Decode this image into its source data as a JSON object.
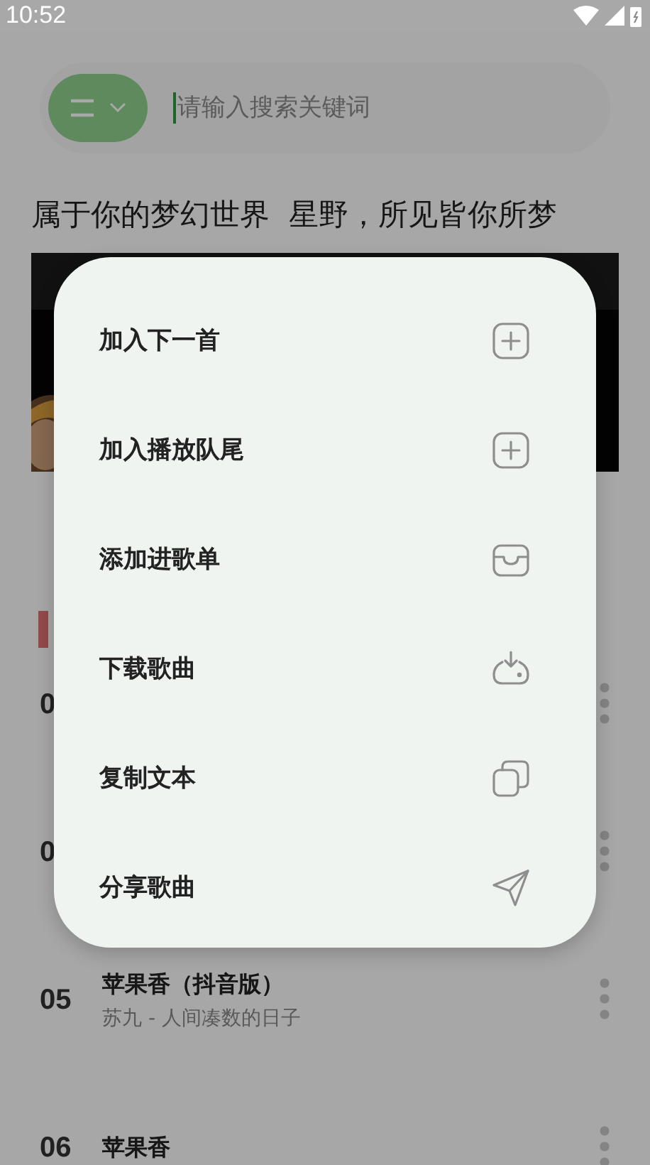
{
  "status_bar": {
    "time": "10:52"
  },
  "search": {
    "placeholder": "请输入搜索关键词"
  },
  "playlist": {
    "title": "属于你的梦幻世界  星野，所见皆你所梦"
  },
  "songs": [
    {
      "index": "0"
    },
    {
      "index": "0"
    },
    {
      "index": "05",
      "title": "苹果香（抖音版）",
      "subtitle": "苏九 - 人间凑数的日子"
    },
    {
      "index": "06",
      "title": "苹果香"
    }
  ],
  "menu": {
    "items": [
      {
        "label": "加入下一首",
        "kind": "add"
      },
      {
        "label": "加入播放队尾",
        "kind": "add"
      },
      {
        "label": "添加进歌单",
        "kind": "playlist"
      },
      {
        "label": "下载歌曲",
        "kind": "download"
      },
      {
        "label": "复制文本",
        "kind": "copy"
      },
      {
        "label": "分享歌曲",
        "kind": "share"
      }
    ]
  }
}
